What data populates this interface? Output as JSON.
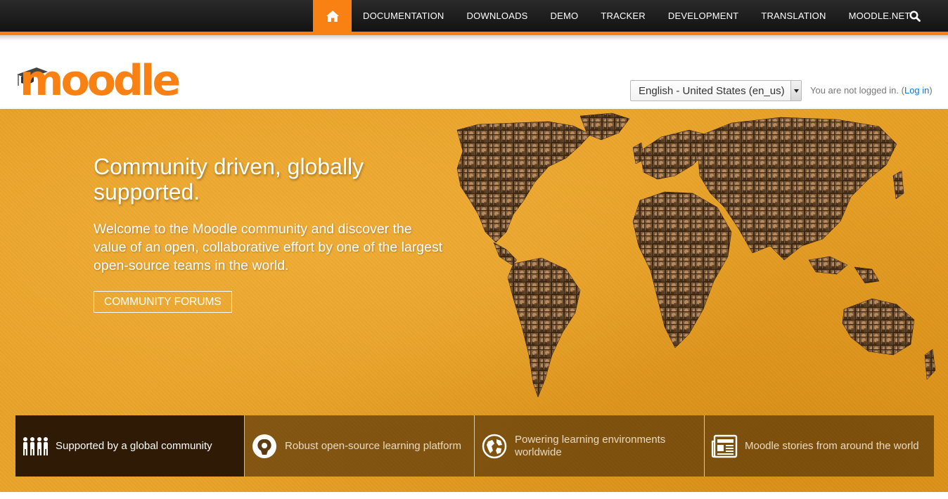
{
  "nav": {
    "home_icon": "home-icon",
    "items": [
      "DOCUMENTATION",
      "DOWNLOADS",
      "DEMO",
      "TRACKER",
      "DEVELOPMENT",
      "TRANSLATION",
      "MOODLE.NET"
    ],
    "search_icon": "search-icon"
  },
  "header": {
    "logo_text": "moodle",
    "language": "English - United States (en_us)",
    "login_text": "You are not logged in. (",
    "login_link": "Log in",
    "login_close": ")"
  },
  "hero": {
    "title": "Community driven, globally supported.",
    "text": "Welcome to the Moodle community and discover the value of an open, collaborative effort by one of the largest open-source teams in the world.",
    "button": "COMMUNITY FORUMS"
  },
  "features": [
    {
      "label": "Supported by a global community",
      "icon": "people-icon"
    },
    {
      "label": "Robust open-source learning platform",
      "icon": "open-source-icon"
    },
    {
      "label": "Powering learning environments worldwide",
      "icon": "globe-icon"
    },
    {
      "label": "Moodle stories from around the world",
      "icon": "newspaper-icon"
    }
  ],
  "colors": {
    "accent": "#f98012",
    "nav_bg": "#1b1b1b",
    "hero_bg": "#e9a127",
    "link": "#1177d1"
  }
}
